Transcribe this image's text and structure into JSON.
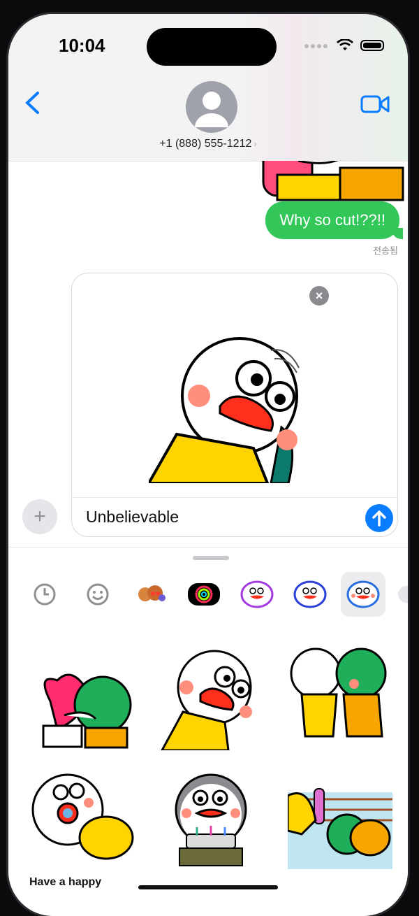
{
  "status_bar": {
    "time": "10:04"
  },
  "conversation": {
    "contact": "+1 (888) 555-1212"
  },
  "messages": [
    {
      "text": "Why so cut!??!!",
      "status": "전송됨"
    }
  ],
  "composer": {
    "value": "Unbelievable"
  },
  "drawer": {
    "tabs": [
      "recents-icon",
      "emoji-icon",
      "memoji-icon",
      "activity-icon",
      "sticker-pack-1",
      "sticker-pack-2",
      "sticker-pack-3"
    ],
    "selected_tab": "sticker-pack-3",
    "stickers": [
      "hug-heart",
      "lean-tilt",
      "push-back",
      "pray-up",
      "cake-birthday",
      "wrestle-ring"
    ],
    "pack_caption": "Have a happy"
  },
  "colors": {
    "accent": "#0a7cff",
    "bubble": "#33c759"
  }
}
